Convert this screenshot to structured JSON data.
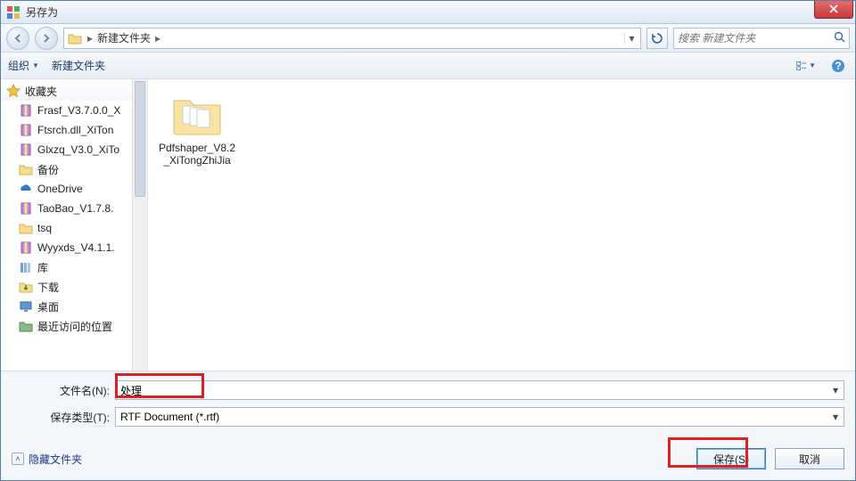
{
  "title": "另存为",
  "nav": {
    "breadcrumb_root_icon": "folder",
    "crumb1": "新建文件夹",
    "search_placeholder": "搜索 新建文件夹"
  },
  "toolbar": {
    "organize": "组织",
    "new_folder": "新建文件夹"
  },
  "sidebar": {
    "favorites_header": "收藏夹",
    "items": [
      {
        "icon": "rar",
        "label": "Frasf_V3.7.0.0_X"
      },
      {
        "icon": "rar",
        "label": "Ftsrch.dll_XiTon"
      },
      {
        "icon": "rar",
        "label": "Glxzq_V3.0_XiTo"
      },
      {
        "icon": "folder",
        "label": "备份"
      },
      {
        "icon": "od",
        "label": "OneDrive"
      },
      {
        "icon": "rar",
        "label": "TaoBao_V1.7.8."
      },
      {
        "icon": "folder",
        "label": "tsq"
      },
      {
        "icon": "rar",
        "label": "Wyyxds_V4.1.1."
      },
      {
        "icon": "lib",
        "label": "库"
      },
      {
        "icon": "dl",
        "label": "下载"
      },
      {
        "icon": "desk",
        "label": "桌面"
      },
      {
        "icon": "recent",
        "label": "最近访问的位置"
      }
    ]
  },
  "content": {
    "items": [
      {
        "name": "Pdfshaper_V8.2_XiTongZhiJia"
      }
    ]
  },
  "form": {
    "filename_label": "文件名(N):",
    "filename_value": "处理",
    "filetype_label": "保存类型(T):",
    "filetype_value": "RTF Document (*.rtf)"
  },
  "actions": {
    "hide": "隐藏文件夹",
    "save": "保存(S)",
    "cancel": "取消"
  }
}
